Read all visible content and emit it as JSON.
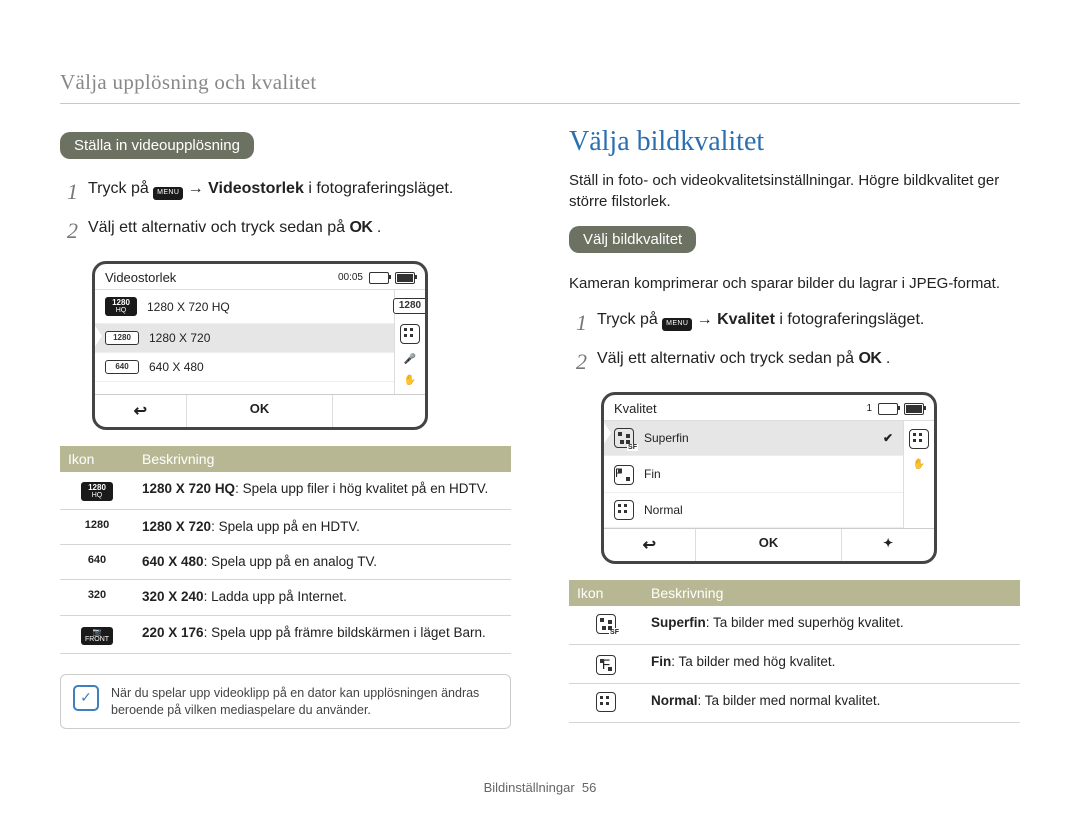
{
  "running_head": "Välja upplösning och kvalitet",
  "left": {
    "pill": "Ställa in videoupplösning",
    "steps": {
      "s1_pre": "Tryck på ",
      "s1_menu": "MENU",
      "s1_arrow": " → ",
      "s1_bold": "Videostorlek",
      "s1_post": " i fotograferingsläget.",
      "s2_pre": "Välj ett alternativ och tryck sedan på ",
      "s2_ok": "OK",
      "s2_post": "."
    },
    "screen": {
      "title": "Videostorlek",
      "time": "00:05",
      "rows": [
        {
          "badge1": "1280",
          "badge2": "HQ",
          "label": "1280 X 720 HQ"
        },
        {
          "badge1": "1280",
          "label": "1280 X 720"
        },
        {
          "badge1": "640",
          "label": "640 X 480"
        }
      ],
      "side_label": "1280",
      "ok": "OK"
    },
    "table": {
      "h1": "Ikon",
      "h2": "Beskrivning",
      "rows": [
        {
          "icon1": "1280",
          "icon2": "HQ",
          "bold": "1280 X 720 HQ",
          "rest": ": Spela upp filer i hög kvalitet på en HDTV."
        },
        {
          "icon1": "1280",
          "bold": "1280 X 720",
          "rest": ": Spela upp på en HDTV."
        },
        {
          "icon1": "640",
          "bold": "640 X 480",
          "rest": ": Spela upp på en analog TV."
        },
        {
          "icon1": "320",
          "bold": "320 X 240",
          "rest": ": Ladda upp på Internet."
        },
        {
          "icon1": "FRONT",
          "bold": "220 X 176",
          "rest": ": Spela upp på främre bildskärmen i läget Barn."
        }
      ]
    },
    "note": "När du spelar upp videoklipp på en dator kan upplösningen ändras beroende på vilken mediaspelare du använder."
  },
  "right": {
    "title": "Välja bildkvalitet",
    "intro": "Ställ in foto- och videokvalitetsinställningar. Högre bildkvalitet ger större filstorlek.",
    "pill": "Välj bildkvalitet",
    "para2": "Kameran komprimerar och sparar bilder du lagrar i JPEG-format.",
    "steps": {
      "s1_pre": "Tryck på ",
      "s1_menu": "MENU",
      "s1_arrow": " → ",
      "s1_bold": "Kvalitet",
      "s1_post": " i fotograferingsläget.",
      "s2_pre": "Välj ett alternativ och tryck sedan på ",
      "s2_ok": "OK",
      "s2_post": "."
    },
    "screen": {
      "title": "Kvalitet",
      "count": "1",
      "rows": [
        {
          "tag": "SF",
          "label": "Superfin",
          "checked": true
        },
        {
          "tag": "F",
          "label": "Fin"
        },
        {
          "tag": "",
          "label": "Normal"
        }
      ],
      "ok": "OK"
    },
    "table": {
      "h1": "Ikon",
      "h2": "Beskrivning",
      "rows": [
        {
          "tag": "SF",
          "bold": "Superfin",
          "rest": ": Ta bilder med superhög kvalitet."
        },
        {
          "tag": "F",
          "bold": "Fin",
          "rest": ": Ta bilder med hög kvalitet."
        },
        {
          "tag": "",
          "bold": "Normal",
          "rest": ": Ta bilder med normal kvalitet."
        }
      ]
    }
  },
  "footer": {
    "section": "Bildinställningar",
    "page": "56"
  }
}
